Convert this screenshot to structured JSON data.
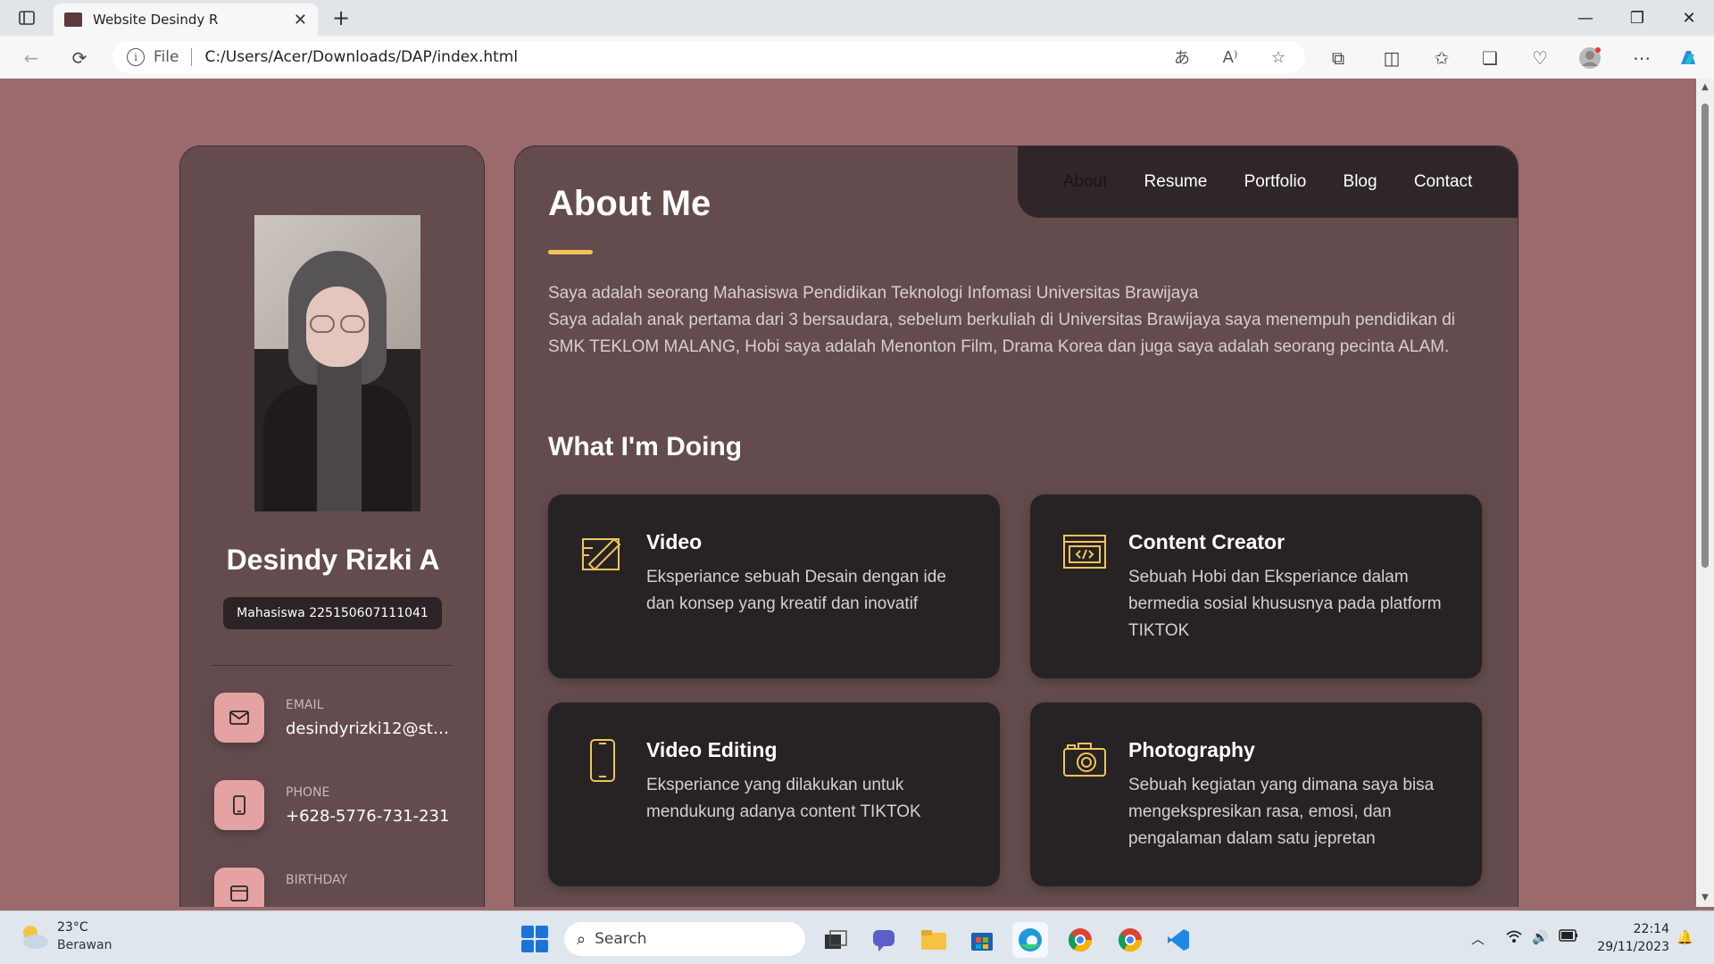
{
  "browser": {
    "tab_title": "Website Desindy R",
    "address_prefix": "File",
    "url": "C:/Users/Acer/Downloads/DAP/index.html"
  },
  "profile": {
    "name": "Desindy Rizki A",
    "badge": "Mahasiswa 225150607111041",
    "contacts": [
      {
        "label": "EMAIL",
        "value": "desindyrizki12@stud...",
        "icon": "mail-icon"
      },
      {
        "label": "PHONE",
        "value": "+628-5776-731-231",
        "icon": "phone-icon"
      },
      {
        "label": "BIRTHDAY",
        "value": "",
        "icon": "calendar-icon"
      }
    ]
  },
  "nav": {
    "items": [
      "About",
      "Resume",
      "Portfolio",
      "Blog",
      "Contact"
    ],
    "active": "About"
  },
  "about": {
    "title": "About Me",
    "paragraph1": "Saya adalah seorang Mahasiswa Pendidikan Teknologi Infomasi Universitas Brawijaya",
    "paragraph2": "Saya adalah anak pertama dari 3 bersaudara, sebelum berkuliah di Universitas Brawijaya saya menempuh pendidikan di SMK TEKLOM MALANG, Hobi saya adalah Menonton Film, Drama Korea dan juga saya adalah seorang pecinta ALAM.",
    "doing_title": "What I'm Doing",
    "services": [
      {
        "title": "Video",
        "desc": "Eksperiance sebuah Desain dengan ide dan konsep yang kreatif dan inovatif",
        "icon": "design-icon"
      },
      {
        "title": "Content Creator",
        "desc": "Sebuah Hobi dan Eksperiance dalam bermedia sosial khususnya pada platform TIKTOK",
        "icon": "code-window-icon"
      },
      {
        "title": "Video Editing",
        "desc": "Eksperiance yang dilakukan untuk mendukung adanya content TIKTOK",
        "icon": "smartphone-icon"
      },
      {
        "title": "Photography",
        "desc": "Sebuah kegiatan yang dimana saya bisa mengekspresikan rasa, emosi, dan pengalaman dalam satu jepretan",
        "icon": "camera-icon"
      }
    ]
  },
  "taskbar": {
    "temperature": "23°C",
    "condition": "Berawan",
    "search_placeholder": "Search",
    "time": "22:14",
    "date": "29/11/2023"
  },
  "colors": {
    "page_bg": "#9a6a6c",
    "panel_bg": "#644c4e",
    "card_bg": "#272324",
    "accent": "#f2c45b",
    "icon_box": "#e5a2a3"
  }
}
